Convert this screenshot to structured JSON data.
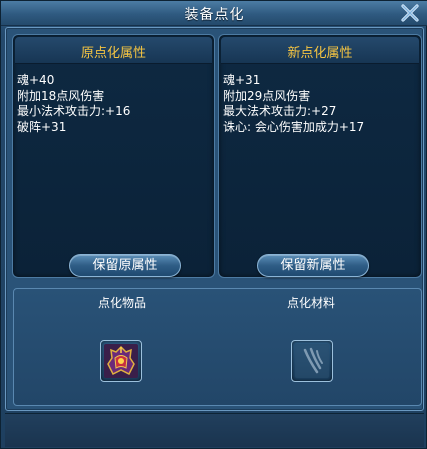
{
  "window": {
    "title": "装备点化",
    "close_icon": "close-x-icon"
  },
  "original_panel": {
    "title": "原点化属性",
    "attributes": [
      "魂+40",
      "附加18点风伤害",
      "最小法术攻击力:+16",
      "破阵+31"
    ],
    "button_label": "保留原属性"
  },
  "new_panel": {
    "title": "新点化属性",
    "attributes": [
      "魂+31",
      "附加29点风伤害",
      "最大法术攻击力:+27",
      "诛心: 会心伤害加成力+17"
    ],
    "button_label": "保留新属性"
  },
  "slots": {
    "item_label": "点化物品",
    "item_icon": "ornate-helmet-icon",
    "material_label": "点化材料",
    "material_icon": "empty-material-claw-icon"
  },
  "colors": {
    "panel_title": "#f6c542",
    "text": "#ffffff"
  }
}
